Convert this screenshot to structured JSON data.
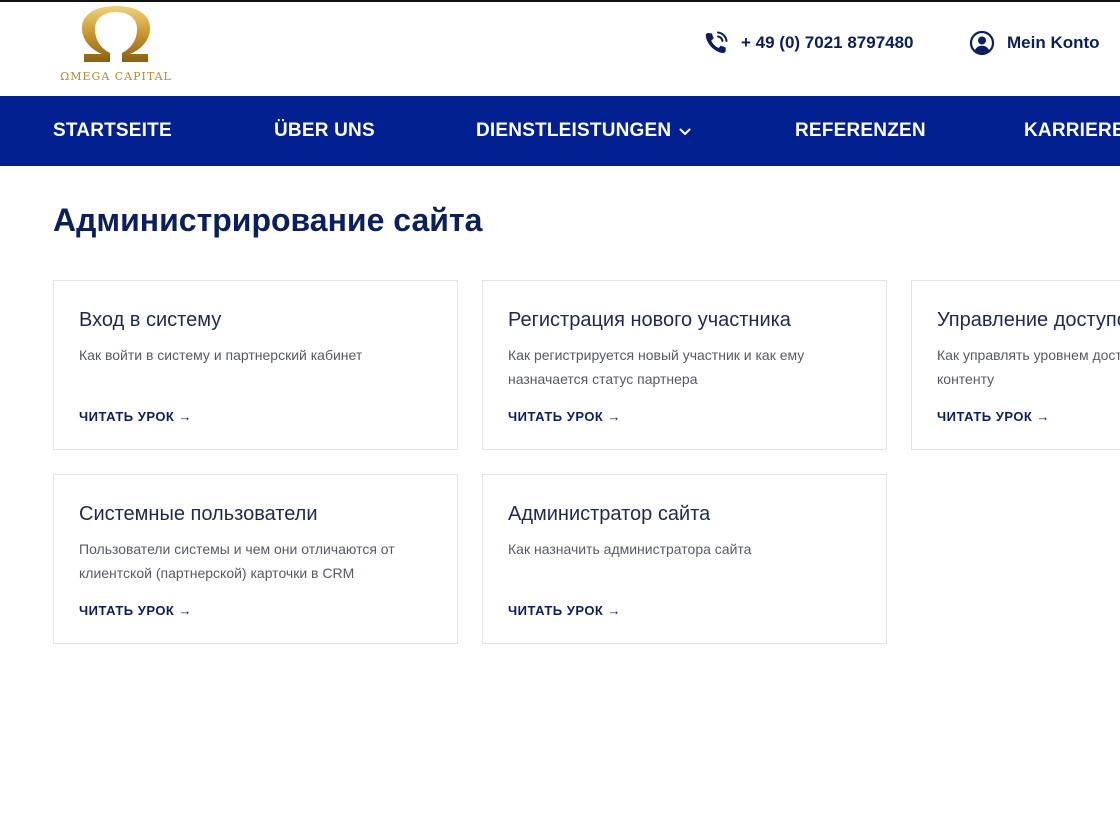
{
  "header": {
    "logo_text": "Omega Capital",
    "phone": "+ 49 (0) 7021 8797480",
    "account_label": "Mein Konto"
  },
  "nav": {
    "items": [
      {
        "label": "STARTSEITE"
      },
      {
        "label": "ÜBER UNS"
      },
      {
        "label": "DIENSTLEISTUNGEN",
        "has_dropdown": true
      },
      {
        "label": "REFERENZEN"
      },
      {
        "label": "KARRIERE"
      }
    ]
  },
  "main": {
    "title": "Администрирование сайта",
    "cards": [
      {
        "title": "Вход в систему",
        "description": "Как войти в систему и партнерский кабинет",
        "link": "ЧИТАТЬ УРОК →"
      },
      {
        "title": "Регистрация нового участника",
        "description": "Как регистрируется новый участник и как ему назначается статус партнера",
        "link": "ЧИТАТЬ УРОК →"
      },
      {
        "title": "Управление доступом",
        "description": "Как управлять уровнем доступа к аккаунту и контенту",
        "link": "ЧИТАТЬ УРОК →"
      },
      {
        "title": "Системные пользователи",
        "description": "Пользователи системы и чем они отличаются от клиентской (партнерской) карточки в CRM",
        "link": "ЧИТАТЬ УРОК →"
      },
      {
        "title": "Администратор сайта",
        "description": "Как назначить администратора сайта",
        "link": "ЧИТАТЬ УРОК →"
      }
    ]
  },
  "colors": {
    "nav_background": "#02208f",
    "text_dark_blue": "#0a1f5c",
    "logo_gold": "#b58a2e"
  }
}
